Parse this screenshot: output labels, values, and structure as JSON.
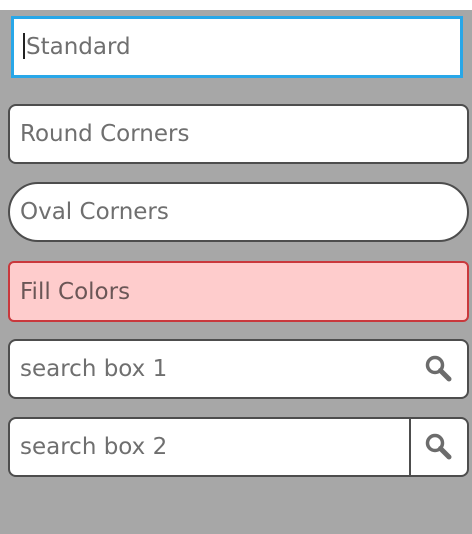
{
  "fields": {
    "standard": {
      "value": "Standard"
    },
    "round": {
      "value": "Round Corners"
    },
    "oval": {
      "value": "Oval Corners"
    },
    "fill": {
      "value": "Fill Colors"
    },
    "search1": {
      "value": "search box 1",
      "icon": "search-icon"
    },
    "search2": {
      "value": "search box 2",
      "icon": "search-icon"
    }
  },
  "colors": {
    "background": "#a7a7a7",
    "focus_border": "#28a7e8",
    "fill_background": "#fecccc",
    "fill_border": "#c9383c",
    "border": "#4d4d4d",
    "text": "#6f6f6f"
  }
}
